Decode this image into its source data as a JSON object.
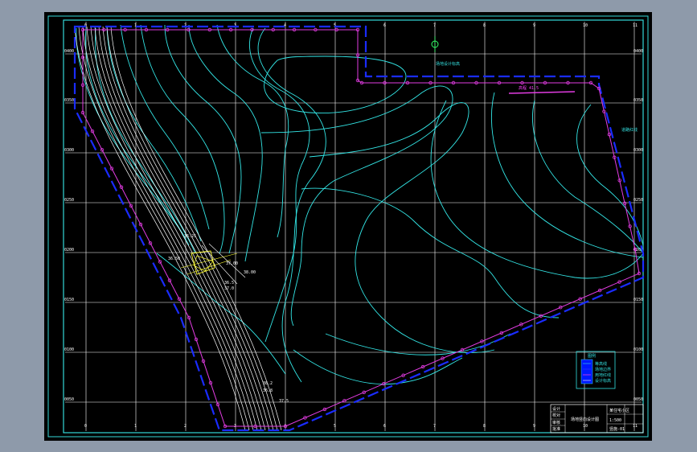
{
  "app": {
    "background_color": "#8e9aaa",
    "canvas_color": "#000000"
  },
  "colors": {
    "grid": "#ffffff",
    "border": "#34d8d8",
    "contour": "#33e6e6",
    "boundary": "#1a2cff",
    "property_line": "#e23ce2",
    "annotation": "#ffffff",
    "detail": "#ffff33",
    "legend_fill": "#0018ff"
  },
  "grid": {
    "row_labels": [
      "0400",
      "0350",
      "0300",
      "0250",
      "0200",
      "0150",
      "0100",
      "0050"
    ],
    "right_labels": [
      "0400",
      "0350",
      "0300",
      "0250",
      "0200",
      "0150",
      "0100",
      "0050"
    ],
    "column_labels": [
      "0",
      "1",
      "2",
      "3",
      "4",
      "5",
      "6",
      "7",
      "8",
      "9",
      "10",
      "11"
    ]
  },
  "annotations": {
    "top_mark": "坐标点",
    "site_label": "场地设计标高",
    "pink_label": "高程 41.5",
    "right_label": "道路红线",
    "node_labels": [
      "36.5",
      "37.0",
      "37.5",
      "38.0"
    ],
    "bottom_labels": [
      "38.2",
      "36.8",
      "37.5"
    ],
    "detail_labels": [
      "36.25",
      "36.50",
      "37.00",
      "38.00"
    ]
  },
  "legend": {
    "title": "图例",
    "items": [
      "等高线",
      "场地边界",
      "用地红线",
      "设计标高"
    ]
  },
  "title_block": {
    "drawing_name": "场地竖向设计图",
    "rows": [
      "设计",
      "校对",
      "审核",
      "批准"
    ],
    "project": "某住宅小区",
    "scale": "1:500",
    "sheet": "竖施-01"
  }
}
